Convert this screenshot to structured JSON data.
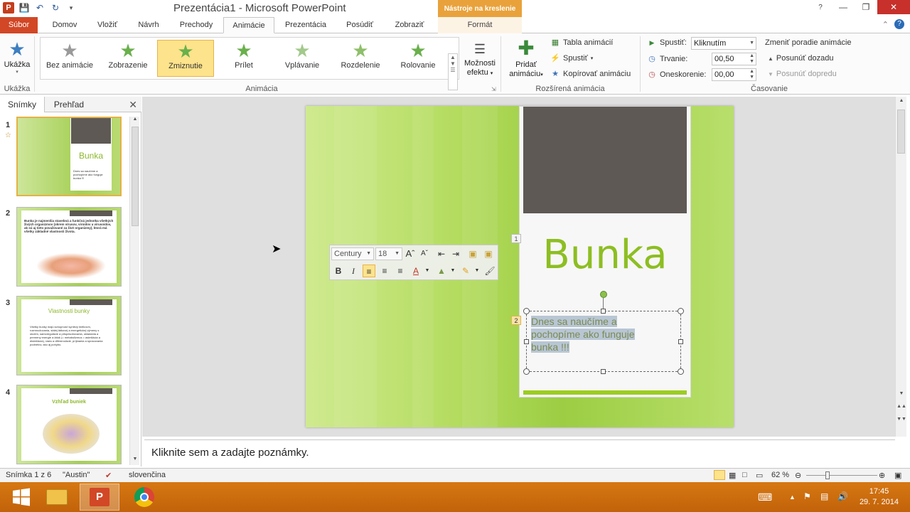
{
  "window": {
    "title": "Prezentácia1  -  Microsoft PowerPoint",
    "context_tab_group": "Nástroje na kreslenie"
  },
  "tabs": [
    {
      "label": "Súbor"
    },
    {
      "label": "Domov"
    },
    {
      "label": "Vložiť"
    },
    {
      "label": "Návrh"
    },
    {
      "label": "Prechody"
    },
    {
      "label": "Animácie"
    },
    {
      "label": "Prezentácia"
    },
    {
      "label": "Posúdiť"
    },
    {
      "label": "Zobraziť"
    },
    {
      "label": "Formát"
    }
  ],
  "ribbon": {
    "preview": {
      "label": "Ukážka",
      "group": "Ukážka"
    },
    "animation_group": "Animácia",
    "animations": [
      {
        "label": "Bez animácie"
      },
      {
        "label": "Zobrazenie"
      },
      {
        "label": "Zmiznutie"
      },
      {
        "label": "Prílet"
      },
      {
        "label": "Vplávanie"
      },
      {
        "label": "Rozdelenie"
      },
      {
        "label": "Rolovanie"
      }
    ],
    "effect_options": {
      "line1": "Možnosti",
      "line2": "efektu"
    },
    "advanced": {
      "add_line1": "Pridať",
      "add_line2": "animáciu",
      "pane": "Tabla animácií",
      "trigger": "Spustiť",
      "painter": "Kopírovať animáciu",
      "group": "Rozšírená animácia"
    },
    "timing": {
      "start_label": "Spustiť:",
      "start_value": "Kliknutím",
      "duration_label": "Trvanie:",
      "duration_value": "00,50",
      "delay_label": "Oneskorenie:",
      "delay_value": "00,00",
      "reorder_title": "Zmeniť poradie animácie",
      "move_earlier": "Posunúť dozadu",
      "move_later": "Posunúť dopredu",
      "group": "Časovanie"
    }
  },
  "left_panel": {
    "tab_slides": "Snímky",
    "tab_outline": "Prehľad",
    "thumbnails": [
      {
        "num": "1",
        "title": "Bunka",
        "text": "Dnes sa naučíme a pochopíme ako funguje bunka !!!"
      },
      {
        "num": "2",
        "title": "",
        "text": "Bunka je najmenšia stavebná a funkčná jednotka všetkých živých organizmov (okrem vírusov, viroidov a virusoidov, ak sú aj tieto považované za živé organizmy), ktorá má všetky základné vlastnosti života."
      },
      {
        "num": "3",
        "title": "Vlastnosti bunky",
        "text": "Všetky bunky majú schopnosť syntézy bielkovín, rozmnožovania, stálej látkovej a energetickej výmeny s okolím, samoregulácie a prispôsobovania, ukladania a premeny energie a látok (= metabolizmus = asimilácia a disimilácia), rastu a diferenciácie, príjmania a spracovania podnetov, ako aj pohybu."
      },
      {
        "num": "4",
        "title": "Vzhľad buniek",
        "text": ""
      }
    ]
  },
  "slide": {
    "title": "Bunka",
    "body_line1": "Dnes sa naučíme  a",
    "body_line2": "pochopíme ako funguje",
    "body_line3": "bunka !!!",
    "anim_tag_1": "1",
    "anim_tag_2": "2"
  },
  "mini_toolbar": {
    "font": "Century",
    "size": "18"
  },
  "notes": {
    "placeholder": "Kliknite sem a zadajte poznámky."
  },
  "status": {
    "slide_info": "Snímka 1 z 6",
    "theme": "\"Austin\"",
    "language": "slovenčina",
    "zoom": "62 %"
  },
  "taskbar": {
    "time": "17:45",
    "date": "29. 7. 2014"
  },
  "colors": {
    "file_tab": "#d24726",
    "context_tab": "#e9a23b",
    "slide_title": "#8dbe22",
    "taskbar": "#c96a0c"
  }
}
